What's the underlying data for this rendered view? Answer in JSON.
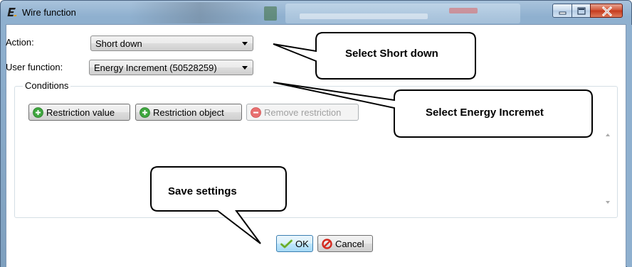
{
  "window": {
    "title": "Wire function",
    "app_icon": "e-letter-icon",
    "controls": [
      "minimize-icon",
      "maximize-icon",
      "close-icon"
    ]
  },
  "form": {
    "action_label": "Action:",
    "action_value": "Short down",
    "user_function_label": "User function:",
    "user_function_value": "Energy Increment (50528259)"
  },
  "conditions": {
    "legend": "Conditions",
    "buttons": [
      {
        "label": "Restriction value",
        "icon": "green-plus-circle-icon",
        "enabled": true
      },
      {
        "label": "Restriction object",
        "icon": "green-plus-circle-icon",
        "enabled": true
      },
      {
        "label": "Remove restriction",
        "icon": "red-minus-circle-icon",
        "enabled": false
      }
    ]
  },
  "footer": {
    "ok_label": "OK",
    "cancel_label": "Cancel"
  },
  "callouts": {
    "short_down": "Select Short down",
    "energy": "Select Energy Incremet",
    "save": "Save settings"
  },
  "colors": {
    "titlebar": "#8fb0cf",
    "close_button": "#c53a1d",
    "ok_border": "#3c7fb1",
    "plus_icon": "#3ea63e",
    "minus_icon": "#e05050",
    "cancel_icon": "#d42a1f"
  }
}
